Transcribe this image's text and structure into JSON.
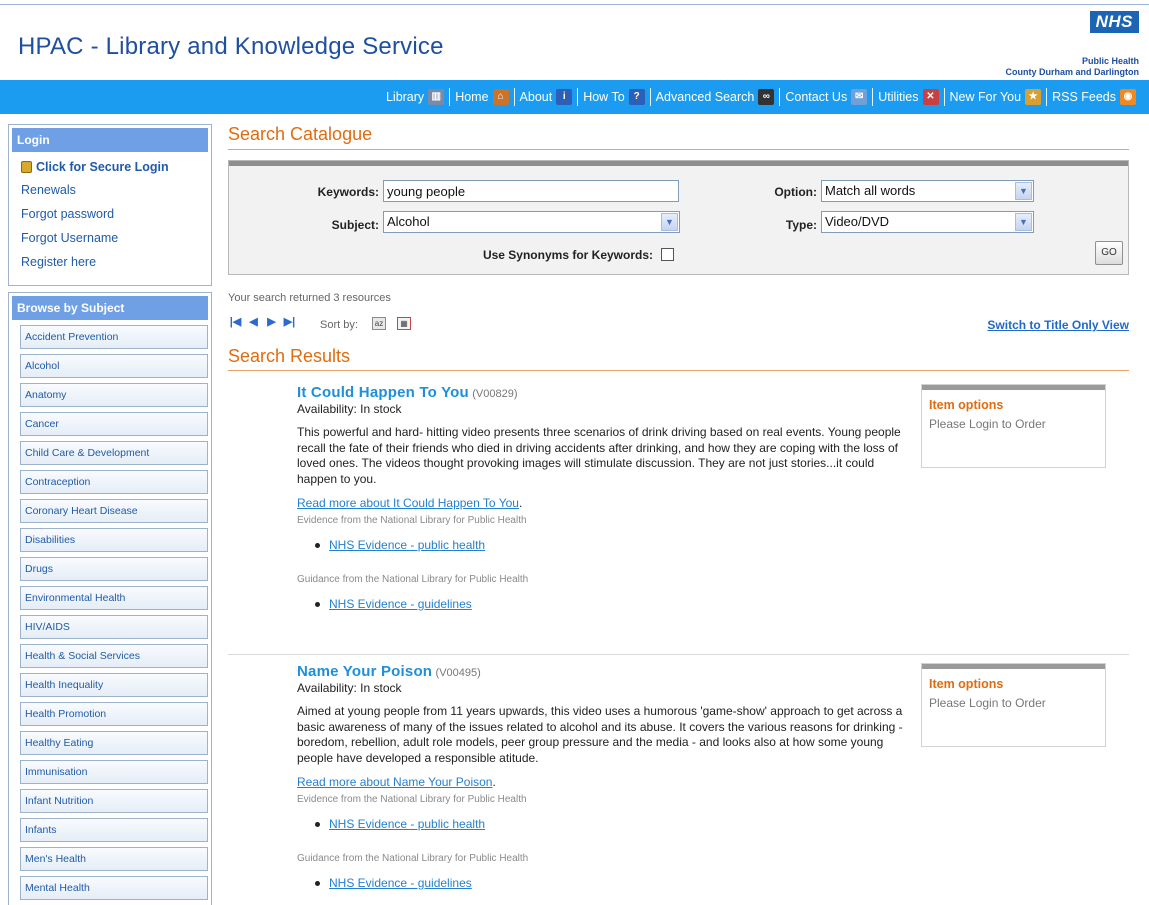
{
  "header": {
    "site_title": "HPAC - Library and Knowledge Service",
    "logo_text": "NHS",
    "org_line1": "Public Health",
    "org_line2": "County Durham and Darlington"
  },
  "nav": [
    {
      "label": "Library",
      "icon": "library-icon",
      "color": "#7a8aa8",
      "glyph": "▥"
    },
    {
      "label": "Home",
      "icon": "home-icon",
      "color": "#c9742a",
      "glyph": "⌂"
    },
    {
      "label": "About",
      "icon": "info-icon",
      "color": "#2c5fb8",
      "glyph": "i"
    },
    {
      "label": "How To",
      "icon": "help-icon",
      "color": "#2c5fb8",
      "glyph": "?"
    },
    {
      "label": "Advanced Search",
      "icon": "binoculars-icon",
      "color": "#333333",
      "glyph": "∞"
    },
    {
      "label": "Contact Us",
      "icon": "mail-icon",
      "color": "#6fa0d8",
      "glyph": "✉"
    },
    {
      "label": "Utilities",
      "icon": "tools-icon",
      "color": "#c84040",
      "glyph": "✕"
    },
    {
      "label": "New For You",
      "icon": "new-icon",
      "color": "#d8a030",
      "glyph": "★"
    },
    {
      "label": "RSS Feeds",
      "icon": "rss-icon",
      "color": "#f08a20",
      "glyph": "◉"
    }
  ],
  "login": {
    "header": "Login",
    "secure_login": "Click for Secure Login",
    "links": [
      "Renewals",
      "Forgot password",
      "Forgot Username",
      "Register here"
    ]
  },
  "browse": {
    "header": "Browse by Subject",
    "subjects": [
      "Accident Prevention",
      "Alcohol",
      "Anatomy",
      "Cancer",
      "Child Care & Development",
      "Contraception",
      "Coronary Heart Disease",
      "Disabilities",
      "Drugs",
      "Environmental Health",
      "HIV/AIDS",
      "Health & Social Services",
      "Health Inequality",
      "Health Promotion",
      "Healthy Eating",
      "Immunisation",
      "Infant Nutrition",
      "Infants",
      "Men's Health",
      "Mental Health"
    ]
  },
  "search": {
    "section_title": "Search Catalogue",
    "keywords_label": "Keywords:",
    "keywords_value": "young people",
    "subject_label": "Subject:",
    "subject_value": "Alcohol",
    "option_label": "Option:",
    "option_value": "Match all words",
    "type_label": "Type:",
    "type_value": "Video/DVD",
    "synonyms_label": "Use Synonyms for Keywords:",
    "synonyms_checked": false,
    "go_label": "GO"
  },
  "results_meta": {
    "count_text": "Your search returned 3 resources",
    "sort_label": "Sort by:",
    "switch_view": "Switch to Title Only View",
    "section_title": "Search Results"
  },
  "results": [
    {
      "title": "It Could Happen To You",
      "code": "(V00829)",
      "availability": "Availability:  In stock",
      "description": "This powerful and hard- hitting video presents three scenarios of drink driving based on real events. Young people recall the fate of their friends who died in driving accidents after drinking, and how they are coping with the loss of loved ones. The videos thought provoking images will stimulate discussion. They are not just stories...it could happen to you.",
      "read_more": "Read more about It Could Happen To You",
      "evidence_label": "Evidence from the National Library for Public Health",
      "evidence_link": "NHS Evidence - public health",
      "guidance_label": "Guidance from the National Library for Public Health",
      "guidance_link": "NHS Evidence - guidelines",
      "options_title": "Item options",
      "options_text": "Please Login to Order"
    },
    {
      "title": "Name Your Poison",
      "code": "(V00495)",
      "availability": "Availability:  In stock",
      "description": "Aimed at young people from 11 years upwards, this video uses a humorous 'game-show' approach to get across a basic awareness of many of the issues related to alcohol and its abuse. It covers the various reasons for drinking - boredom, rebellion, adult role models, peer group pressure and the media - and looks also at how some young people have developed a responsible atitude.",
      "read_more": "Read more about Name Your Poison",
      "evidence_label": "Evidence from the National Library for Public Health",
      "evidence_link": "NHS Evidence - public health",
      "guidance_label": "Guidance from the National Library for Public Health",
      "guidance_link": "NHS Evidence - guidelines",
      "options_title": "Item options",
      "options_text": "Please Login to Order"
    }
  ]
}
